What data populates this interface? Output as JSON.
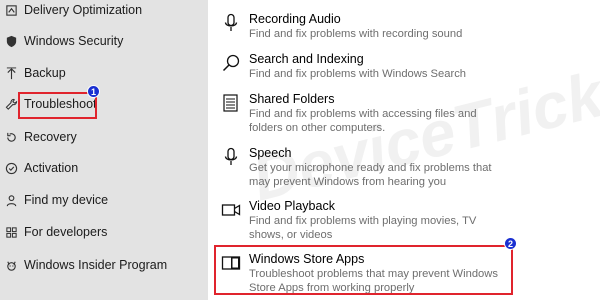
{
  "sidebar": {
    "items": [
      {
        "label": "Delivery Optimization",
        "icon": "delivery-optimization-icon"
      },
      {
        "label": "Windows Security",
        "icon": "shield-icon"
      },
      {
        "label": "Backup",
        "icon": "backup-arrow-icon"
      },
      {
        "label": "Troubleshoot",
        "icon": "wrench-icon"
      },
      {
        "label": "Recovery",
        "icon": "recovery-icon"
      },
      {
        "label": "Activation",
        "icon": "activation-check-icon"
      },
      {
        "label": "Find my device",
        "icon": "find-device-person-icon"
      },
      {
        "label": "For developers",
        "icon": "developers-icon"
      },
      {
        "label": "Windows Insider Program",
        "icon": "insider-cat-icon"
      }
    ]
  },
  "main": {
    "items": [
      {
        "title": "Recording Audio",
        "desc": "Find and fix problems with recording sound",
        "icon": "microphone-icon"
      },
      {
        "title": "Search and Indexing",
        "desc": "Find and fix problems with Windows Search",
        "icon": "search-icon"
      },
      {
        "title": "Shared Folders",
        "desc": "Find and fix problems with accessing files and folders on other computers.",
        "icon": "shared-folders-icon"
      },
      {
        "title": "Speech",
        "desc": "Get your microphone ready and fix problems that may prevent Windows from hearing you",
        "icon": "microphone-icon"
      },
      {
        "title": "Video Playback",
        "desc": "Find and fix problems with playing movies, TV shows, or videos",
        "icon": "video-camera-icon"
      },
      {
        "title": "Windows Store Apps",
        "desc": "Troubleshoot problems that may prevent Windows Store Apps from working properly",
        "icon": "store-apps-icon"
      }
    ]
  },
  "annotations": {
    "step1": "1",
    "step2": "2",
    "highlight_color": "#e0242d",
    "callout_color": "#1a2fd1"
  },
  "watermark": "DeviceTricks"
}
